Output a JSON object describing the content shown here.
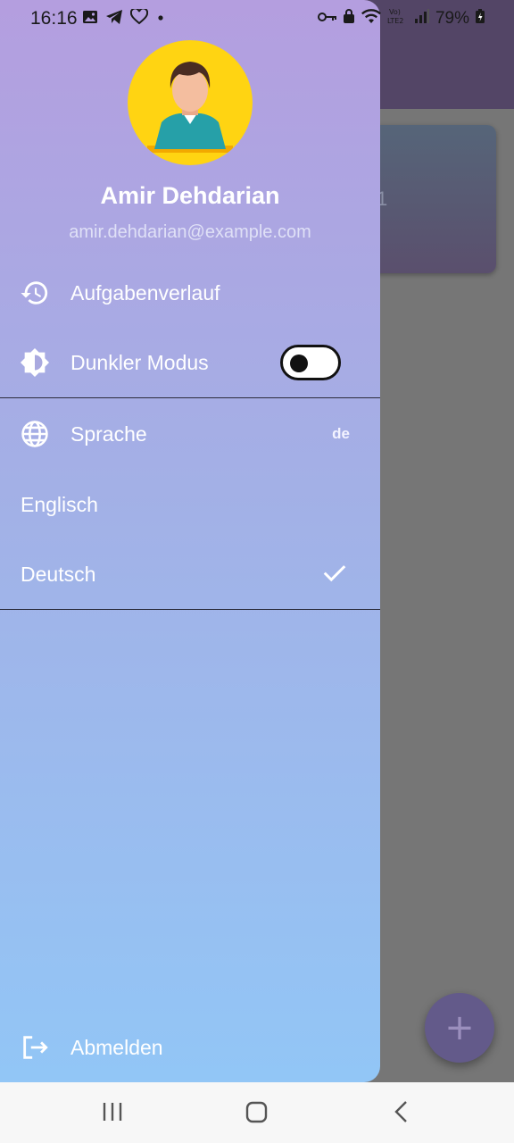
{
  "status_bar": {
    "time": "16:16",
    "battery": "79%",
    "icons": [
      "image-icon",
      "telegram-icon",
      "heart-icon",
      "dot-icon",
      "key-icon",
      "lock-icon",
      "wifi-icon",
      "volte-icon",
      "signal-icon",
      "battery-icon"
    ]
  },
  "background": {
    "card_text": "1",
    "fab_label": "+"
  },
  "drawer": {
    "user": {
      "name": "Amir Dehdarian",
      "email": "amir.dehdarian@example.com"
    },
    "items": {
      "history": "Aufgabenverlauf",
      "dark_mode": "Dunkler Modus",
      "language": "Sprache",
      "language_code": "de",
      "english": "Englisch",
      "german": "Deutsch",
      "logout": "Abmelden"
    },
    "dark_mode_on": false,
    "selected_language": "Deutsch",
    "colors": {
      "gradient_top": "#b49edf",
      "gradient_bottom": "#92c6f6",
      "avatar_bg": "#ffd412"
    }
  },
  "nav_bar": {
    "icons": [
      "recents-icon",
      "home-icon",
      "back-icon"
    ]
  }
}
